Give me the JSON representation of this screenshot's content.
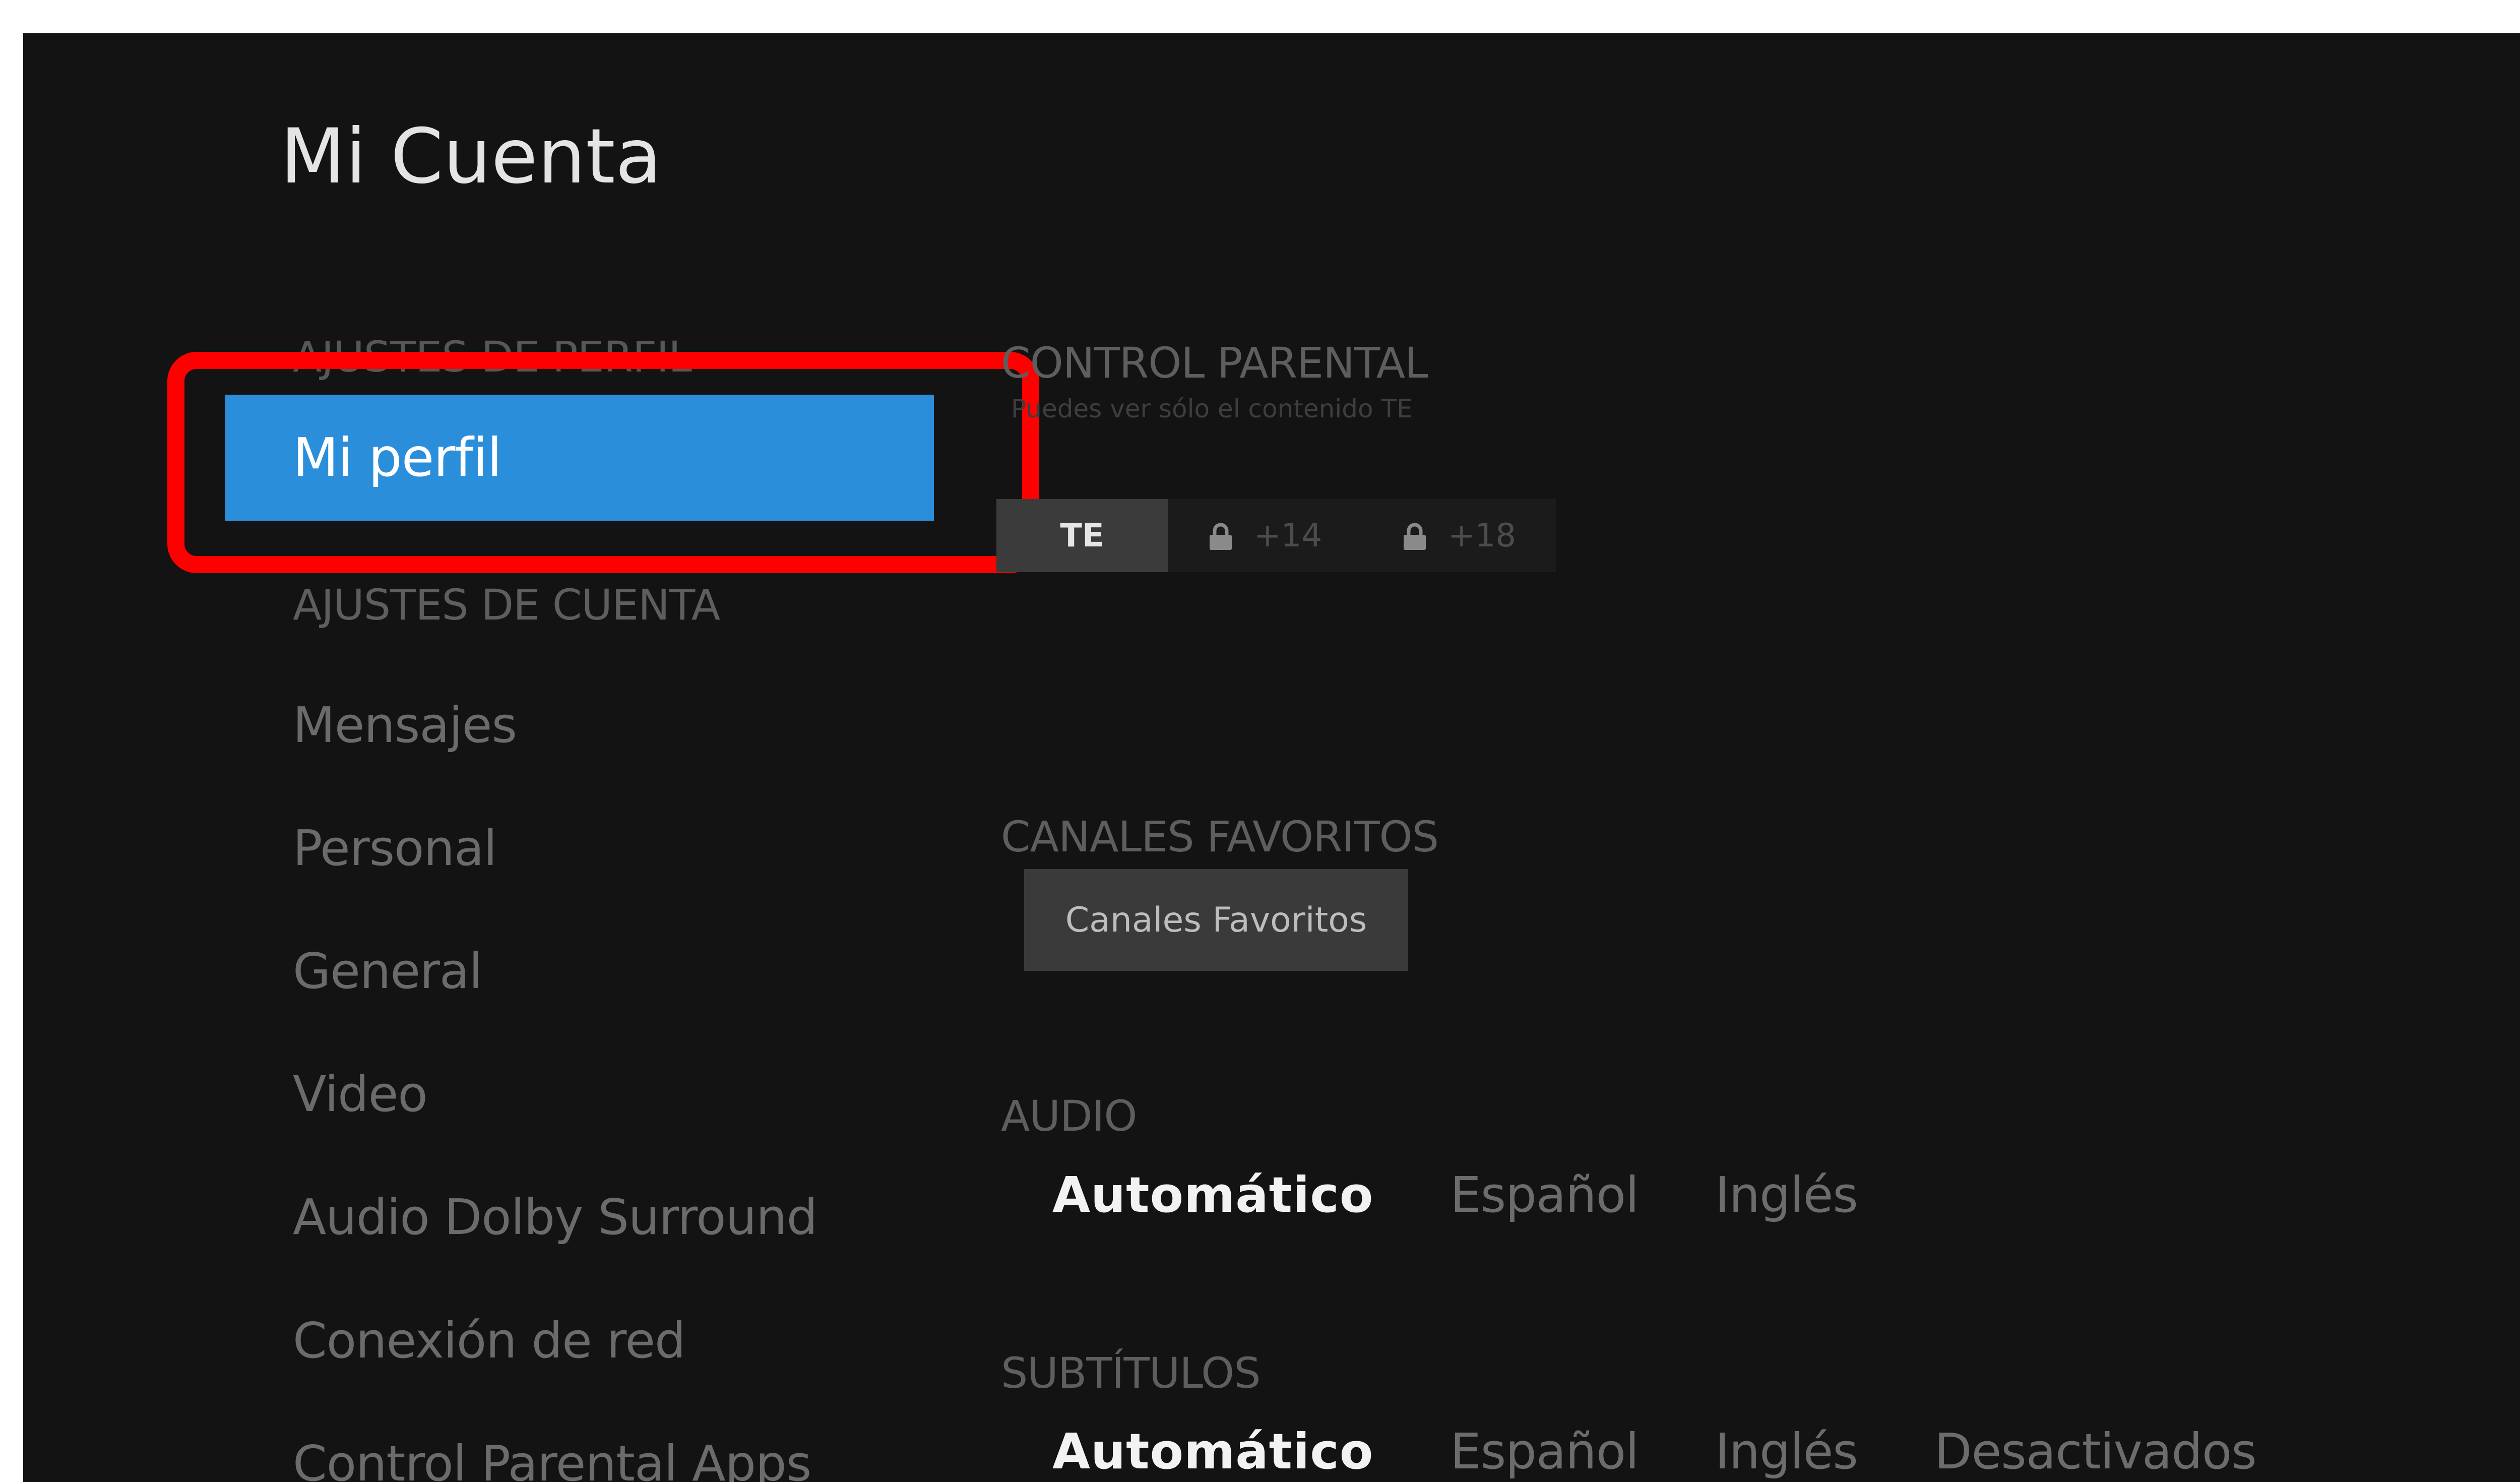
{
  "page": {
    "title": "Mi Cuenta"
  },
  "sidebar": {
    "profile_header": "AJUSTES DE PERFIL",
    "profile_item": "Mi perfil",
    "account_header": "AJUSTES DE CUENTA",
    "items": [
      {
        "label": "Mensajes"
      },
      {
        "label": "Personal"
      },
      {
        "label": "General"
      },
      {
        "label": "Video"
      },
      {
        "label": "Audio Dolby Surround"
      },
      {
        "label": "Conexión de red"
      },
      {
        "label": "Control Parental Apps"
      }
    ]
  },
  "parental": {
    "header": "CONTROL PARENTAL",
    "description": "Puedes ver sólo el contenido TE",
    "options": [
      {
        "label": "TE",
        "selected": true,
        "icon": ""
      },
      {
        "label": "+14",
        "selected": false,
        "icon": "lock-icon"
      },
      {
        "label": "+18",
        "selected": false,
        "icon": "lock-icon"
      }
    ]
  },
  "favorites": {
    "header": "CANALES FAVORITOS",
    "button_label": "Canales Favoritos"
  },
  "audio": {
    "header": "AUDIO",
    "options": [
      "Automático",
      "Español",
      "Inglés"
    ],
    "selected": "Automático"
  },
  "subtitles": {
    "header": "SUBTÍTULOS",
    "options": [
      "Automático",
      "Español",
      "Inglés",
      "Desactivados"
    ],
    "selected": "Automático"
  },
  "colors": {
    "background": "#131313",
    "accent": "#2b8edb",
    "annotation": "#ff0000"
  }
}
